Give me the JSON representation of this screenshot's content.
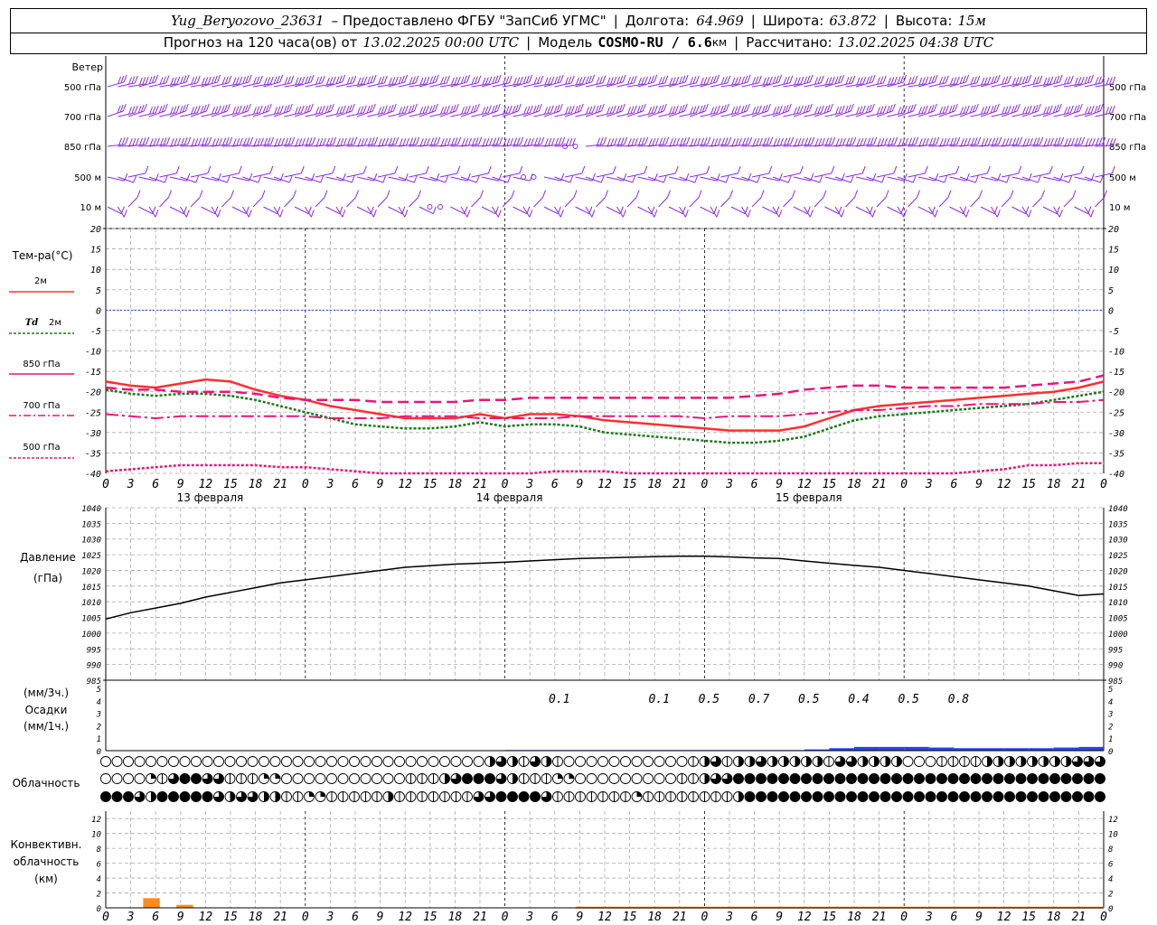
{
  "header": {
    "station": "Yug_Beryozovo_23631",
    "provided_by": "– Предоставлено ФГБУ \"ЗапСиб УГМС\"",
    "lon_label": "Долгота:",
    "lon": "64.969",
    "lat_label": "Широта:",
    "lat": "63.872",
    "alt_label": "Высота:",
    "alt": "15м",
    "forecast": "Прогноз на 120 часа(ов) от",
    "forecast_time": "13.02.2025 00:00 UTC",
    "model_label": "Модель",
    "model": "COSMO-RU / 6.6",
    "model_unit": "км",
    "calc_label": "Рассчитано:",
    "calc_time": "13.02.2025 04:38 UTC"
  },
  "labels": {
    "wind": "Ветер",
    "temp": "Тем-ра(°C)",
    "t2m": "2м",
    "td": "Td",
    "td2m": "2м",
    "t850": "850 гПа",
    "t700": "700 гПа",
    "t500": "500 гПа",
    "pressure": "Давление",
    "pressure_unit": "(гПа)",
    "precip_unit3": "(мм/3ч.)",
    "precip": "Осадки",
    "precip_unit1": "(мм/1ч.)",
    "cloud": "Облачность",
    "conv1": "Конвективн.",
    "conv2": "облачность",
    "conv3": "(км)"
  },
  "colors": {
    "wind": "#8a2be2",
    "t2m": "#ff3030",
    "td": "#1a7a1a",
    "levels": "#e8157a",
    "zero": "#2244ff",
    "precip": "#2244ee",
    "conv": "#ff8c1a"
  },
  "chart_data": [
    {
      "type": "wind-barbs",
      "levels": [
        "500 гПа",
        "700 гПа",
        "850 гПа",
        "500 м",
        "10 м"
      ],
      "note_calm": "o"
    },
    {
      "type": "line",
      "x_hours": [
        0,
        3,
        6,
        9,
        12,
        15,
        18,
        21,
        24,
        27,
        30,
        33,
        36,
        39,
        42,
        45,
        48,
        51,
        54,
        57,
        60,
        63,
        66,
        69,
        72,
        75,
        78,
        81,
        84,
        87,
        90,
        93,
        96,
        99,
        102,
        105,
        108,
        111,
        114,
        117,
        120
      ],
      "yticks": [
        20,
        15,
        10,
        5,
        0,
        -5,
        -10,
        -15,
        -20,
        -25,
        -30,
        -35,
        -40
      ],
      "ylim": [
        -40,
        20
      ],
      "series": [
        {
          "name": "2м",
          "values": [
            -17.5,
            -18.5,
            -19,
            -18,
            -17,
            -17.5,
            -19.5,
            -21,
            -22,
            -23.5,
            -24.5,
            -25.5,
            -26.5,
            -26.5,
            -26.5,
            -25.5,
            -26.5,
            -25.5,
            -25.5,
            -26,
            -27,
            -27.5,
            -28,
            -28.5,
            -29,
            -29.5,
            -29.5,
            -29.5,
            -28.5,
            -26.5,
            -24.5,
            -23.5,
            -23,
            -22.5,
            -22,
            -21.5,
            -21,
            -20.5,
            -20,
            -19,
            -17.5
          ]
        },
        {
          "name": "Td 2м",
          "values": [
            -19.5,
            -20.5,
            -21,
            -20.5,
            -20.5,
            -21,
            -22,
            -23.5,
            -25,
            -26.5,
            -28,
            -28.5,
            -29,
            -29,
            -28.5,
            -27.5,
            -28.5,
            -28,
            -28,
            -28.5,
            -30,
            -30.5,
            -31,
            -31.5,
            -32,
            -32.5,
            -32.5,
            -32,
            -31,
            -29,
            -27,
            -26,
            -25.5,
            -25,
            -24.5,
            -24,
            -23.5,
            -23,
            -22,
            -21,
            -20
          ]
        },
        {
          "name": "850 гПа",
          "values": [
            -19,
            -19.5,
            -19.5,
            -20,
            -20,
            -20,
            -20.5,
            -21.5,
            -22,
            -22,
            -22,
            -22.5,
            -22.5,
            -22.5,
            -22.5,
            -22,
            -22,
            -21.5,
            -21.5,
            -21.5,
            -21.5,
            -21.5,
            -21.5,
            -21.5,
            -21.5,
            -21.5,
            -21,
            -20.5,
            -19.5,
            -19,
            -18.5,
            -18.5,
            -19,
            -19,
            -19,
            -19,
            -19,
            -18.5,
            -18,
            -17.5,
            -16
          ]
        },
        {
          "name": "700 гПа",
          "values": [
            -25.5,
            -26,
            -26.5,
            -26,
            -26,
            -26,
            -26,
            -26,
            -26,
            -26.5,
            -26.5,
            -26.5,
            -26,
            -26,
            -26,
            -26.5,
            -26.5,
            -26.5,
            -26.5,
            -26,
            -26,
            -26,
            -26,
            -26,
            -26.5,
            -26,
            -26,
            -26,
            -25.5,
            -25,
            -24.5,
            -24.5,
            -24,
            -23.5,
            -23.5,
            -23,
            -23,
            -23,
            -22.5,
            -22.5,
            -22
          ]
        },
        {
          "name": "500 гПа",
          "values": [
            -39.5,
            -39,
            -38.5,
            -38,
            -38,
            -38,
            -38,
            -38.5,
            -38.5,
            -39,
            -39.5,
            -40,
            -40.5,
            -40.5,
            -40.5,
            -40.5,
            -40.5,
            -40,
            -39.5,
            -39.5,
            -39.5,
            -40,
            -40,
            -40,
            -40,
            -40.5,
            -40.5,
            -40.5,
            -40.5,
            -40.5,
            -40.5,
            -40.5,
            -40.5,
            -40.5,
            -40,
            -39.5,
            -39,
            -38,
            -38,
            -37.5,
            -37.5
          ]
        }
      ],
      "date_labels": [
        {
          "hour": 12,
          "text": "13 февраля"
        },
        {
          "hour": 48,
          "text": "14 февраля"
        },
        {
          "hour": 84,
          "text": "15 февраля"
        }
      ]
    },
    {
      "type": "line",
      "name": "Давление",
      "yticks": [
        1040,
        1035,
        1030,
        1025,
        1020,
        1015,
        1010,
        1005,
        1000,
        995,
        990,
        985
      ],
      "ylim": [
        985,
        1040
      ],
      "x_hours": [
        0,
        3,
        6,
        9,
        12,
        15,
        18,
        21,
        24,
        27,
        30,
        33,
        36,
        39,
        42,
        45,
        48,
        51,
        54,
        57,
        60,
        63,
        66,
        69,
        72,
        75,
        78,
        81,
        84,
        87,
        90,
        93,
        96,
        99,
        102,
        105,
        108,
        111,
        114,
        117,
        120
      ],
      "values": [
        1004.5,
        1006.5,
        1008,
        1009.5,
        1011.5,
        1013,
        1014.5,
        1016,
        1017,
        1018,
        1019,
        1020,
        1021,
        1021.5,
        1022,
        1022.3,
        1022.6,
        1023,
        1023.4,
        1023.8,
        1024,
        1024.2,
        1024.4,
        1024.5,
        1024.5,
        1024.3,
        1024,
        1023.8,
        1023,
        1022.3,
        1021.6,
        1021,
        1020,
        1019,
        1018,
        1017,
        1016,
        1015,
        1013.5,
        1012,
        1012.5
      ]
    },
    {
      "type": "bar",
      "name": "Осадки",
      "yticks": [
        5,
        4,
        3,
        2,
        1,
        0
      ],
      "ylim": [
        0,
        5
      ],
      "x_hours": [
        51,
        54,
        57,
        60,
        63,
        66,
        69,
        72,
        75,
        78,
        81,
        84,
        87,
        90,
        93,
        96,
        99,
        102,
        105,
        108,
        111,
        114,
        117,
        120
      ],
      "values_1h": [
        0.05,
        0.05,
        0.05,
        0.05,
        0.05,
        0.05,
        0.05,
        0.05,
        0.05,
        0.05,
        0.05,
        0.05,
        0.1,
        0.2,
        0.3,
        0.3,
        0.3,
        0.25,
        0.2,
        0.2,
        0.2,
        0.2,
        0.25,
        0.3
      ],
      "labels_3h": [
        {
          "hour": 54,
          "text": "0.1"
        },
        {
          "hour": 66,
          "text": "0.1"
        },
        {
          "hour": 72,
          "text": "0.5"
        },
        {
          "hour": 78,
          "text": "0.7"
        },
        {
          "hour": 84,
          "text": "0.5"
        },
        {
          "hour": 90,
          "text": "0.4"
        },
        {
          "hour": 96,
          "text": "0.5"
        },
        {
          "hour": 102,
          "text": "0.8"
        }
      ]
    },
    {
      "type": "cloud-symbols",
      "rows": 3,
      "note": "0 = clear (empty circle) .. 8 = overcast (filled circle)",
      "row_values": [
        [
          0,
          0,
          0,
          0,
          0,
          0,
          0,
          0,
          0,
          0,
          0,
          0,
          0,
          0,
          0,
          0,
          0,
          0,
          0,
          0,
          0,
          0,
          0,
          0,
          0,
          0,
          0,
          0,
          0,
          0,
          0,
          0,
          0,
          0,
          5,
          6,
          5,
          4,
          6,
          5,
          4,
          0,
          0,
          0,
          0,
          0,
          0,
          0,
          0,
          0,
          0,
          0,
          4,
          5,
          6,
          4,
          5,
          5,
          6,
          5,
          5,
          5,
          5,
          5,
          4,
          6,
          6,
          5,
          5,
          5,
          5,
          0,
          0,
          0,
          4,
          4,
          4,
          4,
          5,
          5,
          5,
          5,
          5,
          5,
          5,
          5,
          6,
          6,
          7
        ],
        [
          0,
          0,
          0,
          0,
          3,
          4,
          6,
          8,
          8,
          6,
          6,
          4,
          4,
          4,
          2,
          2,
          0,
          0,
          0,
          0,
          0,
          0,
          0,
          0,
          0,
          0,
          0,
          4,
          4,
          4,
          5,
          6,
          8,
          8,
          8,
          6,
          5,
          4,
          4,
          4,
          2,
          2,
          0,
          0,
          0,
          0,
          0,
          0,
          0,
          0,
          0,
          4,
          4,
          5,
          6,
          7,
          8,
          8,
          8,
          8,
          8,
          8,
          8,
          8,
          8,
          8,
          8,
          8,
          8,
          8,
          8,
          8,
          8,
          8,
          8,
          8,
          8,
          8,
          8,
          8,
          8,
          8,
          8,
          8,
          8,
          8,
          8,
          8,
          8
        ],
        [
          8,
          8,
          8,
          6,
          5,
          8,
          8,
          8,
          8,
          8,
          6,
          5,
          6,
          6,
          5,
          5,
          4,
          4,
          2,
          2,
          4,
          4,
          4,
          4,
          4,
          5,
          4,
          4,
          4,
          4,
          4,
          4,
          4,
          6,
          6,
          8,
          8,
          8,
          8,
          6,
          4,
          4,
          4,
          4,
          4,
          4,
          4,
          2,
          4,
          4,
          4,
          4,
          4,
          4,
          4,
          4,
          5,
          8,
          8,
          8,
          8,
          8,
          8,
          8,
          8,
          8,
          8,
          8,
          8,
          8,
          8,
          8,
          8,
          8,
          8,
          8,
          8,
          8,
          8,
          8,
          8,
          8,
          8,
          8,
          8,
          8,
          8,
          8,
          8
        ]
      ]
    },
    {
      "type": "bar",
      "name": "Конвективн. облачность",
      "yticks": [
        12,
        10,
        8,
        6,
        4,
        2,
        0
      ],
      "ylim": [
        0,
        13
      ],
      "segments": [
        {
          "from": 4.5,
          "to": 6.5,
          "value": 1.3
        },
        {
          "from": 8.5,
          "to": 10.5,
          "value": 0.4
        },
        {
          "from": 56.5,
          "to": 120,
          "value": 0.15
        }
      ]
    }
  ],
  "x_ticks": [
    "0",
    "3",
    "6",
    "9",
    "12",
    "15",
    "18",
    "21",
    "0",
    "3",
    "6",
    "9",
    "12",
    "15",
    "18",
    "21",
    "0",
    "3",
    "6",
    "9",
    "12",
    "15",
    "18",
    "21",
    "0",
    "3",
    "6"
  ]
}
